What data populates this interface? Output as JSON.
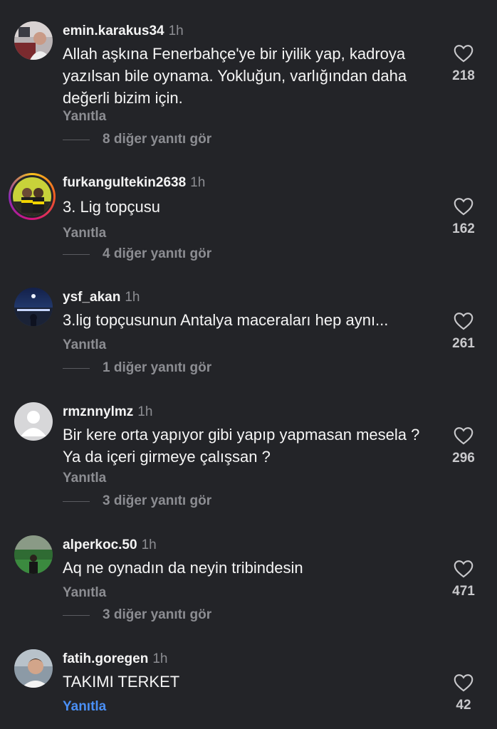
{
  "comments": [
    {
      "username": "emin.karakus34",
      "time": "1h",
      "text": "Allah aşkına Fenerbahçe'ye bir iyilik yap, kadroya yazılsan bile oynama. Yokluğun, varlığından daha değerli bizim için.",
      "reply_label": "Yanıtla",
      "more_replies": "8 diğer yanıtı gör",
      "likes": "218",
      "avatar_icon": "user-photo-avatar"
    },
    {
      "username": "furkangultekin2638",
      "time": "1h",
      "text": "3. Lig topçusu",
      "reply_label": "Yanıtla",
      "more_replies": "4 diğer yanıtı gör",
      "likes": "162",
      "avatar_icon": "user-photo-avatar-story-ring"
    },
    {
      "username": "ysf_akan",
      "time": "1h",
      "text": "3.lig topçusunun Antalya maceraları hep aynı...",
      "reply_label": "Yanıtla",
      "more_replies": "1 diğer yanıtı gör",
      "likes": "261",
      "avatar_icon": "user-photo-avatar"
    },
    {
      "username": "rmznnylmz",
      "time": "1h",
      "text": "Bir kere orta yapıyor gibi yapıp yapmasan mesela ? Ya da içeri girmeye çalışsan ?",
      "reply_label": "Yanıtla",
      "more_replies": "3 diğer yanıtı gör",
      "likes": "296",
      "avatar_icon": "default-user-avatar"
    },
    {
      "username": "alperkoc.50",
      "time": "1h",
      "text": "Aq ne oynadın da neyin tribindesin",
      "reply_label": "Yanıtla",
      "more_replies": "3 diğer yanıtı gör",
      "likes": "471",
      "avatar_icon": "user-photo-avatar"
    },
    {
      "username": "fatih.goregen",
      "time": "1h",
      "text": "TAKIMI TERKET",
      "reply_label": "Yanıtla",
      "likes": "42",
      "avatar_icon": "user-photo-avatar"
    }
  ],
  "colors": {
    "background": "#232428",
    "secondary_text": "#8c8d92",
    "reply_active": "#4a8ff5"
  }
}
